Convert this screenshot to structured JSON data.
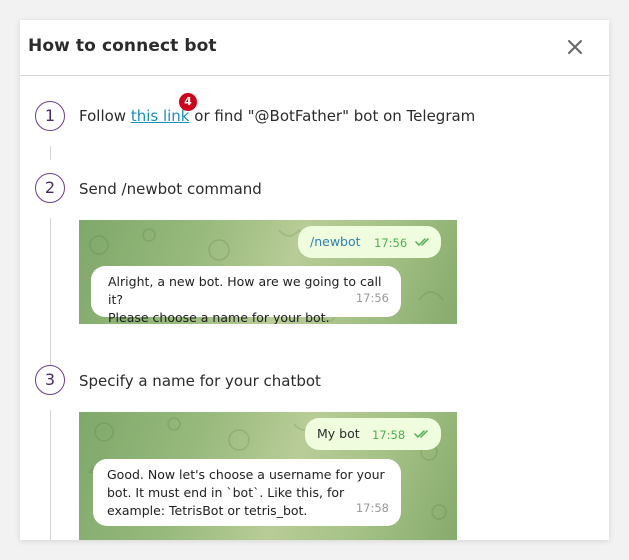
{
  "header": {
    "title": "How to connect bot"
  },
  "steps": [
    {
      "number": "1",
      "before_link": "Follow ",
      "link_text": "this link",
      "after_link": " or find \"@BotFather\" bot on Telegram",
      "badge": "4"
    },
    {
      "number": "2",
      "text": "Send /newbot command",
      "chat": {
        "outgoing": {
          "text": "/newbot",
          "time": "17:56"
        },
        "incoming": {
          "line1": "Alright, a new bot. How are we going to call it?",
          "line2": "Please choose a name for your bot.",
          "time": "17:56"
        }
      }
    },
    {
      "number": "3",
      "text": "Specify a name for your chatbot",
      "chat": {
        "outgoing": {
          "text": "My bot",
          "time": "17:58"
        },
        "incoming": {
          "line1": "Good. Now let's choose a username for your",
          "line2": "bot. It must end in `bot`. Like this, for",
          "line3": "example: TetrisBot or tetris_bot.",
          "time": "17:58"
        }
      }
    }
  ],
  "colors": {
    "accent_purple": "#6a3f83",
    "link_blue": "#1a8fbf",
    "badge_red": "#d0021b",
    "chat_out_bg": "#effdde",
    "chat_green": "#4fae4e"
  },
  "icons": [
    "close-icon",
    "double-check-icon"
  ]
}
